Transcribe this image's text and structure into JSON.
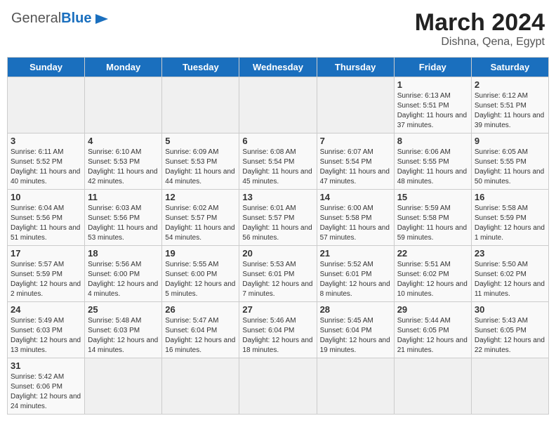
{
  "header": {
    "logo_general": "General",
    "logo_blue": "Blue",
    "title": "March 2024",
    "subtitle": "Dishna, Qena, Egypt"
  },
  "days_of_week": [
    "Sunday",
    "Monday",
    "Tuesday",
    "Wednesday",
    "Thursday",
    "Friday",
    "Saturday"
  ],
  "weeks": [
    [
      {
        "day": "",
        "info": ""
      },
      {
        "day": "",
        "info": ""
      },
      {
        "day": "",
        "info": ""
      },
      {
        "day": "",
        "info": ""
      },
      {
        "day": "",
        "info": ""
      },
      {
        "day": "1",
        "info": "Sunrise: 6:13 AM\nSunset: 5:51 PM\nDaylight: 11 hours and 37 minutes."
      },
      {
        "day": "2",
        "info": "Sunrise: 6:12 AM\nSunset: 5:51 PM\nDaylight: 11 hours and 39 minutes."
      }
    ],
    [
      {
        "day": "3",
        "info": "Sunrise: 6:11 AM\nSunset: 5:52 PM\nDaylight: 11 hours and 40 minutes."
      },
      {
        "day": "4",
        "info": "Sunrise: 6:10 AM\nSunset: 5:53 PM\nDaylight: 11 hours and 42 minutes."
      },
      {
        "day": "5",
        "info": "Sunrise: 6:09 AM\nSunset: 5:53 PM\nDaylight: 11 hours and 44 minutes."
      },
      {
        "day": "6",
        "info": "Sunrise: 6:08 AM\nSunset: 5:54 PM\nDaylight: 11 hours and 45 minutes."
      },
      {
        "day": "7",
        "info": "Sunrise: 6:07 AM\nSunset: 5:54 PM\nDaylight: 11 hours and 47 minutes."
      },
      {
        "day": "8",
        "info": "Sunrise: 6:06 AM\nSunset: 5:55 PM\nDaylight: 11 hours and 48 minutes."
      },
      {
        "day": "9",
        "info": "Sunrise: 6:05 AM\nSunset: 5:55 PM\nDaylight: 11 hours and 50 minutes."
      }
    ],
    [
      {
        "day": "10",
        "info": "Sunrise: 6:04 AM\nSunset: 5:56 PM\nDaylight: 11 hours and 51 minutes."
      },
      {
        "day": "11",
        "info": "Sunrise: 6:03 AM\nSunset: 5:56 PM\nDaylight: 11 hours and 53 minutes."
      },
      {
        "day": "12",
        "info": "Sunrise: 6:02 AM\nSunset: 5:57 PM\nDaylight: 11 hours and 54 minutes."
      },
      {
        "day": "13",
        "info": "Sunrise: 6:01 AM\nSunset: 5:57 PM\nDaylight: 11 hours and 56 minutes."
      },
      {
        "day": "14",
        "info": "Sunrise: 6:00 AM\nSunset: 5:58 PM\nDaylight: 11 hours and 57 minutes."
      },
      {
        "day": "15",
        "info": "Sunrise: 5:59 AM\nSunset: 5:58 PM\nDaylight: 11 hours and 59 minutes."
      },
      {
        "day": "16",
        "info": "Sunrise: 5:58 AM\nSunset: 5:59 PM\nDaylight: 12 hours and 1 minute."
      }
    ],
    [
      {
        "day": "17",
        "info": "Sunrise: 5:57 AM\nSunset: 5:59 PM\nDaylight: 12 hours and 2 minutes."
      },
      {
        "day": "18",
        "info": "Sunrise: 5:56 AM\nSunset: 6:00 PM\nDaylight: 12 hours and 4 minutes."
      },
      {
        "day": "19",
        "info": "Sunrise: 5:55 AM\nSunset: 6:00 PM\nDaylight: 12 hours and 5 minutes."
      },
      {
        "day": "20",
        "info": "Sunrise: 5:53 AM\nSunset: 6:01 PM\nDaylight: 12 hours and 7 minutes."
      },
      {
        "day": "21",
        "info": "Sunrise: 5:52 AM\nSunset: 6:01 PM\nDaylight: 12 hours and 8 minutes."
      },
      {
        "day": "22",
        "info": "Sunrise: 5:51 AM\nSunset: 6:02 PM\nDaylight: 12 hours and 10 minutes."
      },
      {
        "day": "23",
        "info": "Sunrise: 5:50 AM\nSunset: 6:02 PM\nDaylight: 12 hours and 11 minutes."
      }
    ],
    [
      {
        "day": "24",
        "info": "Sunrise: 5:49 AM\nSunset: 6:03 PM\nDaylight: 12 hours and 13 minutes."
      },
      {
        "day": "25",
        "info": "Sunrise: 5:48 AM\nSunset: 6:03 PM\nDaylight: 12 hours and 14 minutes."
      },
      {
        "day": "26",
        "info": "Sunrise: 5:47 AM\nSunset: 6:04 PM\nDaylight: 12 hours and 16 minutes."
      },
      {
        "day": "27",
        "info": "Sunrise: 5:46 AM\nSunset: 6:04 PM\nDaylight: 12 hours and 18 minutes."
      },
      {
        "day": "28",
        "info": "Sunrise: 5:45 AM\nSunset: 6:04 PM\nDaylight: 12 hours and 19 minutes."
      },
      {
        "day": "29",
        "info": "Sunrise: 5:44 AM\nSunset: 6:05 PM\nDaylight: 12 hours and 21 minutes."
      },
      {
        "day": "30",
        "info": "Sunrise: 5:43 AM\nSunset: 6:05 PM\nDaylight: 12 hours and 22 minutes."
      }
    ],
    [
      {
        "day": "31",
        "info": "Sunrise: 5:42 AM\nSunset: 6:06 PM\nDaylight: 12 hours and 24 minutes."
      },
      {
        "day": "",
        "info": ""
      },
      {
        "day": "",
        "info": ""
      },
      {
        "day": "",
        "info": ""
      },
      {
        "day": "",
        "info": ""
      },
      {
        "day": "",
        "info": ""
      },
      {
        "day": "",
        "info": ""
      }
    ]
  ]
}
